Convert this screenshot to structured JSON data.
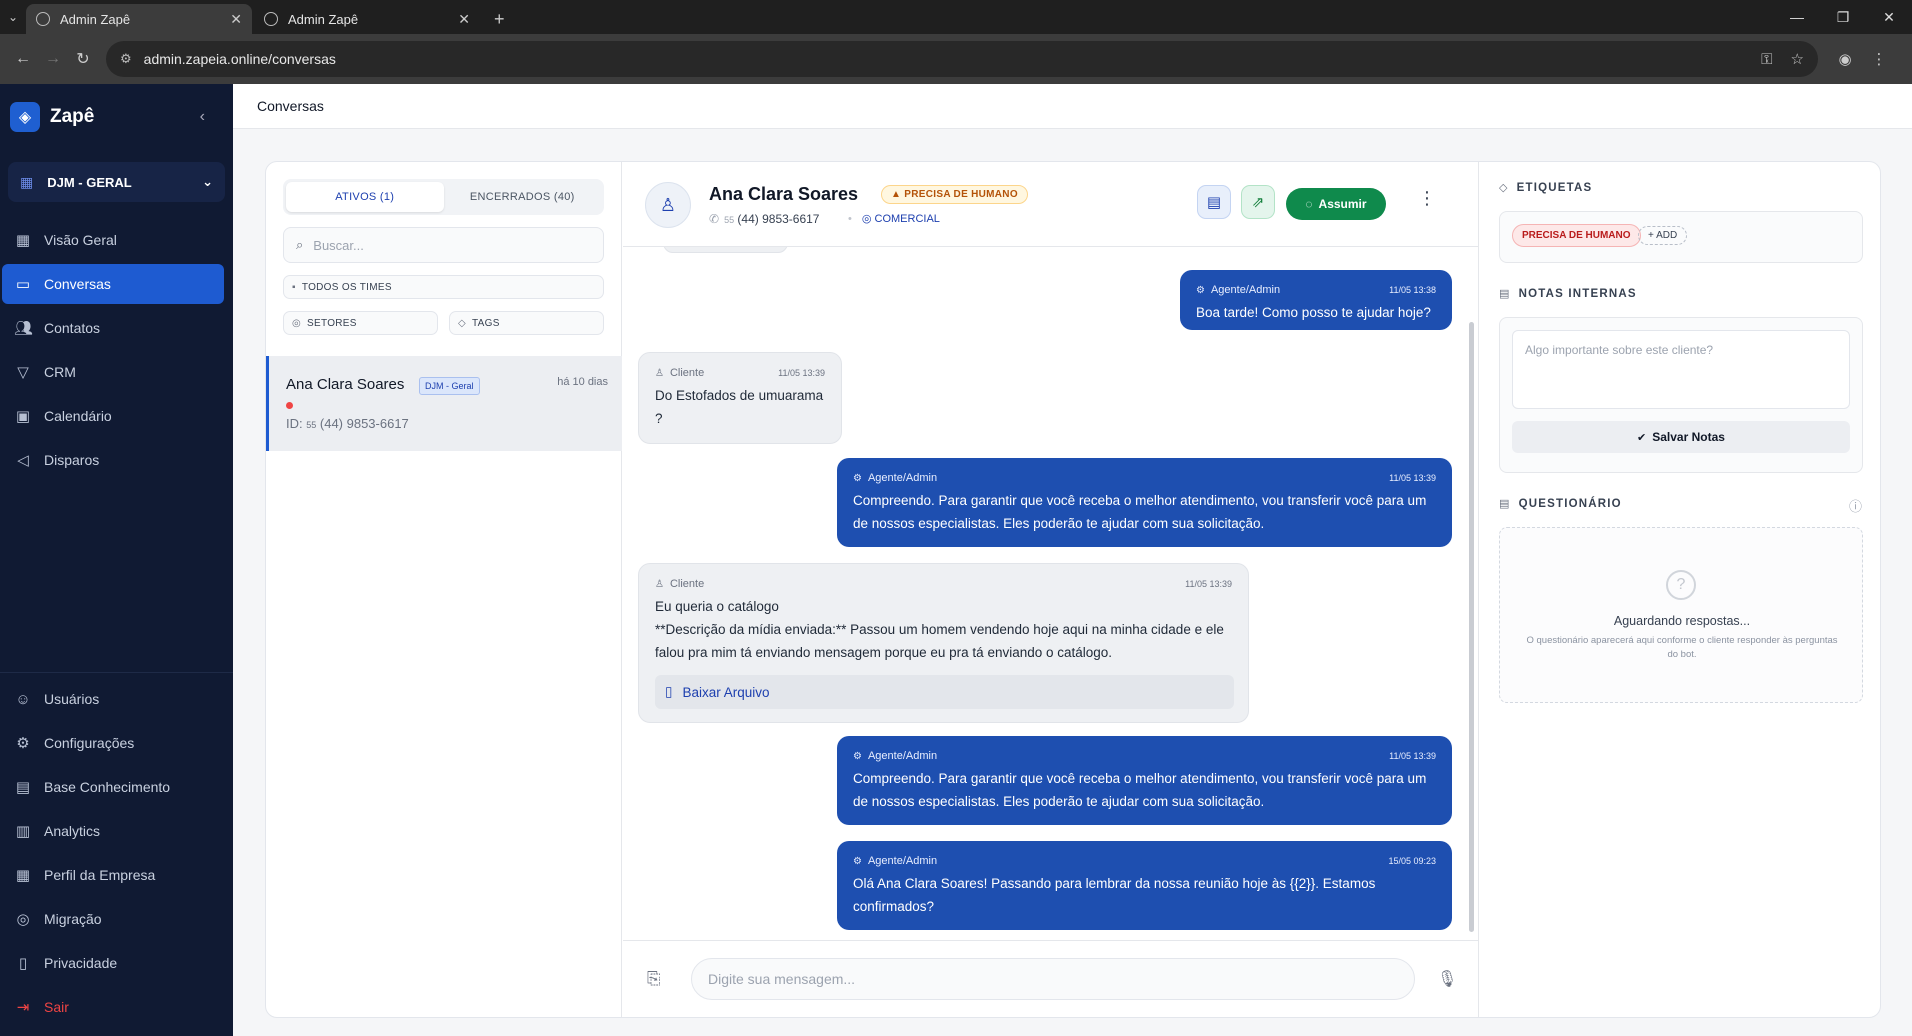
{
  "browser": {
    "tabs": [
      {
        "title": "Admin Zapê",
        "active": true
      },
      {
        "title": "Admin Zapê",
        "active": false
      }
    ],
    "url": "admin.zapeia.online/conversas"
  },
  "sidebar": {
    "brand": "Zapê",
    "org": "DJM - GERAL",
    "items": [
      {
        "label": "Visão Geral",
        "icon": "dashboard-icon",
        "active": false
      },
      {
        "label": "Conversas",
        "icon": "chat-icon",
        "active": true
      },
      {
        "label": "Contatos",
        "icon": "users-icon",
        "active": false
      },
      {
        "label": "CRM",
        "icon": "filter-icon",
        "active": false
      },
      {
        "label": "Calendário",
        "icon": "calendar-icon",
        "active": false
      },
      {
        "label": "Disparos",
        "icon": "megaphone-icon",
        "active": false
      }
    ],
    "bottom_items": [
      {
        "label": "Usuários",
        "icon": "user-icon"
      },
      {
        "label": "Configurações",
        "icon": "gear-icon"
      },
      {
        "label": "Base Conhecimento",
        "icon": "book-icon"
      },
      {
        "label": "Analytics",
        "icon": "chart-icon"
      },
      {
        "label": "Perfil da Empresa",
        "icon": "building-icon"
      },
      {
        "label": "Migração",
        "icon": "database-icon"
      },
      {
        "label": "Privacidade",
        "icon": "document-icon"
      },
      {
        "label": "Sair",
        "icon": "logout-icon"
      }
    ]
  },
  "header": {
    "title": "Conversas"
  },
  "conversations": {
    "tab_active": "ATIVOS (1)",
    "tab_closed": "ENCERRADOS (40)",
    "search_placeholder": "Buscar...",
    "filter_teams": "TODOS OS TIMES",
    "filter_sectors": "SETORES",
    "filter_tags": "TAGS",
    "items": [
      {
        "name": "Ana Clara Soares",
        "badge": "DJM - Geral",
        "time": "há 10 dias",
        "id_label": "ID:",
        "country_code": "55",
        "phone": "(44) 9853-6617"
      }
    ]
  },
  "chat": {
    "contact_name": "Ana Clara Soares",
    "status_badge": "PRECISA DE HUMANO",
    "country_code": "55",
    "phone": "(44) 9853-6617",
    "sector": "COMERCIAL",
    "assume_label": "Assumir",
    "messages": [
      {
        "from": "Agente/Admin",
        "time": "11/05 13:38",
        "text": "Boa tarde! Como posso te ajudar hoje?"
      },
      {
        "from": "Cliente",
        "time": "11/05 13:39",
        "text": "Do Estofados de umuarama ?"
      },
      {
        "from": "Agente/Admin",
        "time": "11/05 13:39",
        "text": "Compreendo. Para garantir que você receba o melhor atendimento, vou transferir você para um de nossos especialistas. Eles poderão te ajudar com sua solicitação."
      },
      {
        "from": "Cliente",
        "time": "11/05 13:39",
        "line1": "Eu queria o catálogo",
        "line2": "**Descrição da mídia enviada:** Passou um homem vendendo hoje aqui na minha cidade e ele falou pra mim tá enviando mensagem porque eu pra tá enviando o catálogo.",
        "file_label": "Baixar Arquivo"
      },
      {
        "from": "Agente/Admin",
        "time": "11/05 13:39",
        "text": "Compreendo. Para garantir que você receba o melhor atendimento, vou transferir você para um de nossos especialistas. Eles poderão te ajudar com sua solicitação."
      },
      {
        "from": "Agente/Admin",
        "time": "15/05 09:23",
        "text": "Olá Ana Clara Soares! Passando para lembrar da nossa reunião hoje às {{2}}. Estamos confirmados?"
      }
    ],
    "composer_placeholder": "Digite sua mensagem..."
  },
  "panel": {
    "tags_title": "ETIQUETAS",
    "tag": "PRECISA DE HUMANO",
    "add_label": "+ ADD",
    "notes_title": "NOTAS INTERNAS",
    "notes_placeholder": "Algo importante sobre este cliente?",
    "save_label": "Salvar Notas",
    "quiz_title": "QUESTIONÁRIO",
    "quiz_waiting": "Aguardando respostas...",
    "quiz_desc": "O questionário aparecerá aqui conforme o cliente responder às perguntas do bot."
  },
  "colors": {
    "sidebar_bg": "#101a33",
    "accent": "#1e5bd1",
    "agent_bubble": "#1e4fb0",
    "assume_green": "#0f8a4c",
    "alert_red": "#ef4444"
  }
}
